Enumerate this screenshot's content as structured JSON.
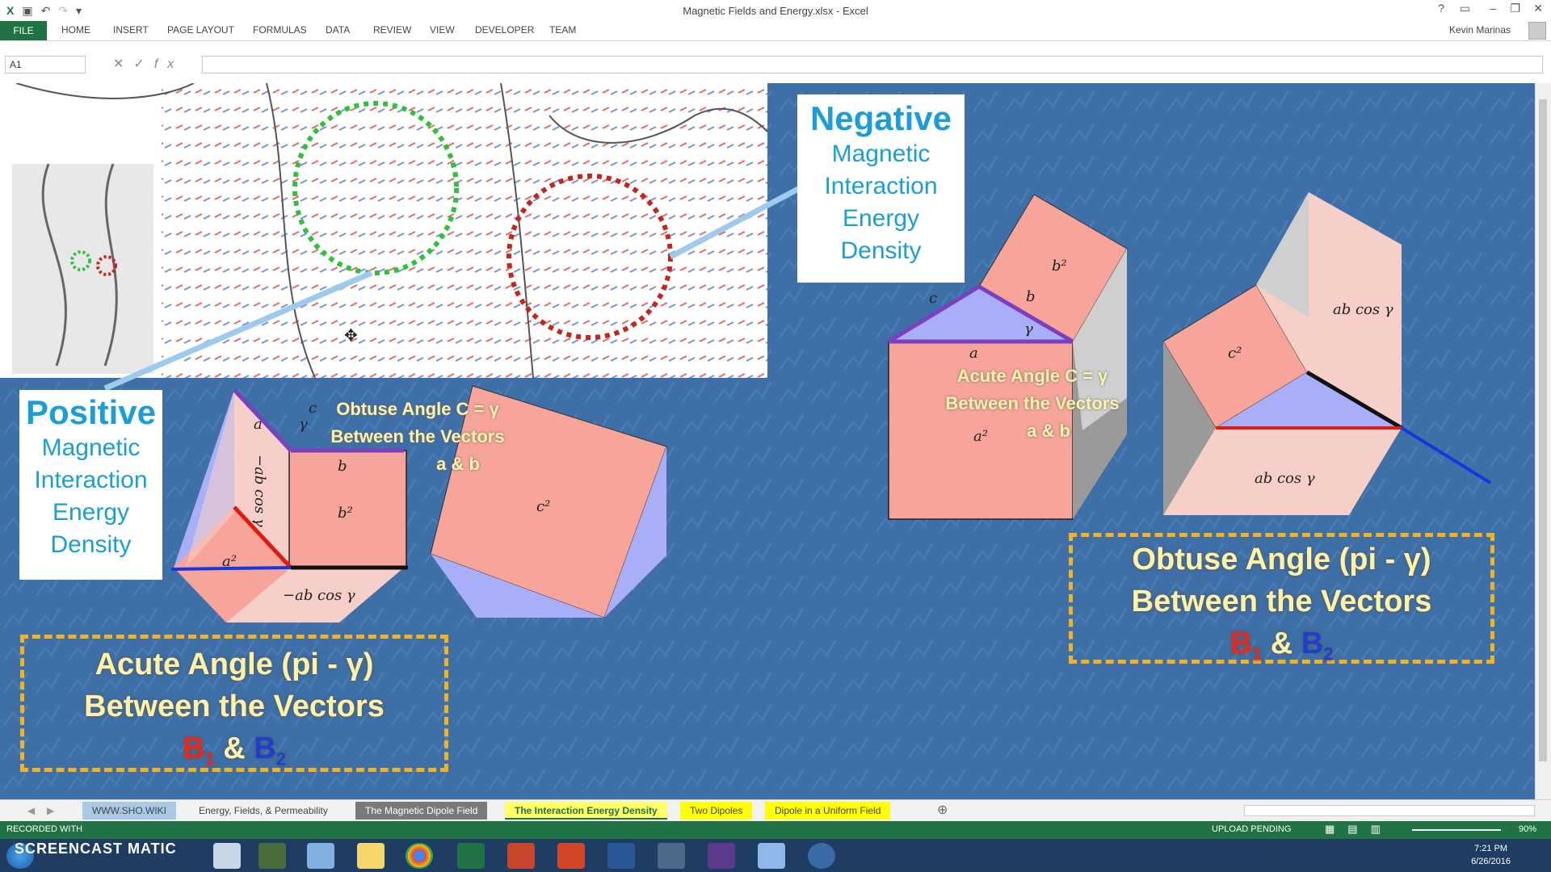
{
  "window": {
    "title": "Magnetic Fields and Energy.xlsx - Excel",
    "help": "?",
    "minimize": "–",
    "restore": "❐",
    "close": "✕"
  },
  "ribbon": {
    "tabs": [
      "FILE",
      "HOME",
      "INSERT",
      "PAGE LAYOUT",
      "FORMULAS",
      "DATA",
      "REVIEW",
      "VIEW",
      "DEVELOPER",
      "TEAM"
    ],
    "user": "Kevin Marinas"
  },
  "formula_bar": {
    "name_box": "A1",
    "value": ""
  },
  "sheet": {
    "negative_box": {
      "title": "Negative",
      "lines": [
        "Magnetic",
        "Interaction",
        "Energy",
        "Density"
      ]
    },
    "positive_box": {
      "title": "Positive",
      "lines": [
        "Magnetic",
        "Interaction",
        "Energy",
        "Density"
      ]
    },
    "left_label": {
      "line1": "Obtuse Angle C = γ",
      "line2": "Between the Vectors",
      "line3": "a & b"
    },
    "right_label": {
      "line1": "Acute Angle C = γ",
      "line2": "Between the Vectors",
      "line3": "a & b"
    },
    "acute_box": {
      "line1": "Acute Angle (pi - γ)",
      "line2": "Between the Vectors",
      "b1": "B",
      "b1_sub": "1",
      "amp": "&",
      "b2": "B",
      "b2_sub": "2"
    },
    "obtuse_box": {
      "line1": "Obtuse Angle (pi - γ)",
      "line2": "Between the Vectors",
      "b1": "B",
      "b1_sub": "1",
      "amp": "&",
      "b2": "B",
      "b2_sub": "2"
    },
    "math": {
      "a": "a",
      "b": "b",
      "c": "c",
      "gamma": "γ",
      "b2": "b²",
      "c2": "c²",
      "a2": "a²",
      "neg_abcos": "−ab cos γ",
      "abcos": "ab cos γ"
    }
  },
  "sheet_tabs": [
    "WWW.SHO.WIKI",
    "Energy, Fields, & Permeability",
    "The Magnetic Dipole Field",
    "The Interaction Energy Density",
    "Two Dipoles",
    "Dipole in a Uniform Field"
  ],
  "status": {
    "left": "RECORDED WITH",
    "upload": "UPLOAD PENDING",
    "zoom": "90%"
  },
  "taskbar": {
    "watermark": "SCREENCAST MATIC",
    "time": "7:21 PM",
    "date": "6/26/2016"
  }
}
